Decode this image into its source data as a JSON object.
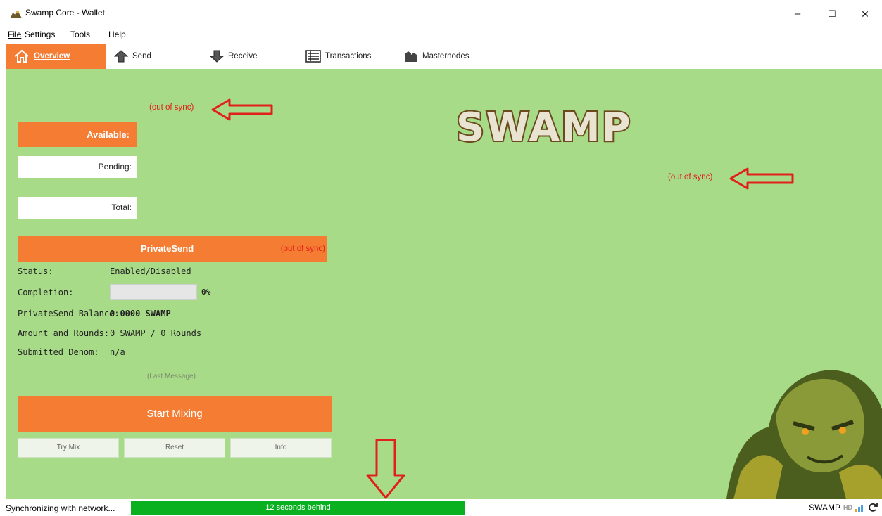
{
  "window": {
    "title": "Swamp Core - Wallet",
    "minimize": "–",
    "maximize": "☐",
    "close": "✕"
  },
  "menu": [
    {
      "label": "File"
    },
    {
      "label": "Settings"
    },
    {
      "label": "Tools"
    },
    {
      "label": "Help"
    }
  ],
  "tabs": [
    {
      "label": "Overview",
      "icon": "home-icon",
      "active": true
    },
    {
      "label": "Send",
      "icon": "send-arrow-icon"
    },
    {
      "label": "Receive",
      "icon": "receive-arrow-icon"
    },
    {
      "label": "Transactions",
      "icon": "transactions-list-icon"
    },
    {
      "label": "Masternodes",
      "icon": "masternodes-icon"
    }
  ],
  "balances": {
    "out_of_sync": "(out of sync)",
    "available_label": "Available:",
    "pending_label": "Pending:",
    "total_label": "Total:"
  },
  "recent": {
    "out_of_sync": "(out of sync)"
  },
  "logo": {
    "text": "SWAMP"
  },
  "privatesend": {
    "title": "PrivateSend",
    "out_of_sync": "(out of sync)",
    "status_label": "Status:",
    "status_value": "Enabled/Disabled",
    "completion_label": "Completion:",
    "completion_value": "0%",
    "completion_fraction": 0,
    "balance_label": "PrivateSend Balance:",
    "balance_value": "0.0000 SWAMP",
    "rounds_label": "Amount and Rounds:",
    "rounds_value": "0 SWAMP / 0 Rounds",
    "denom_label": "Submitted Denom:",
    "denom_value": "n/a",
    "last_message": "(Last Message)",
    "start_button": "Start Mixing",
    "try_mix": "Try Mix",
    "reset": "Reset",
    "info": "Info"
  },
  "statusbar": {
    "sync_text": "Synchronizing with network...",
    "progress_text": "12 seconds behind",
    "unit": "SWAMP",
    "hd_label": "HD"
  },
  "colors": {
    "accent": "#f47c33",
    "background": "#a8db88",
    "warning": "#e0201a",
    "progress": "#09b020"
  }
}
